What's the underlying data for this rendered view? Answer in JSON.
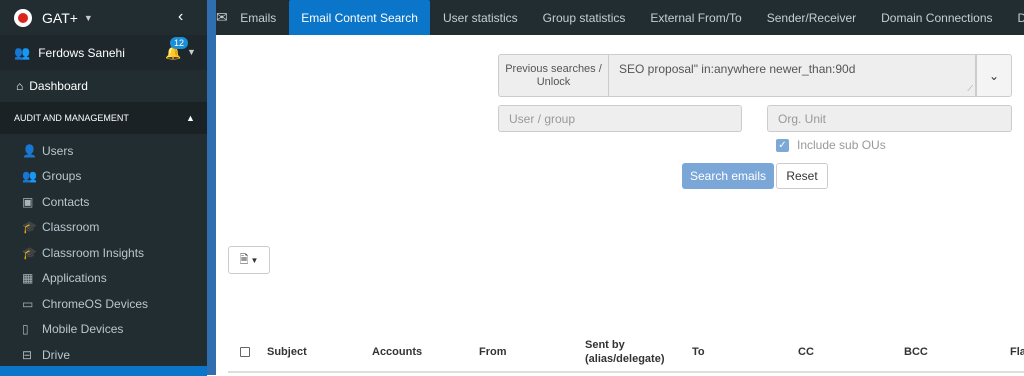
{
  "app": {
    "title": "GAT+"
  },
  "user": {
    "name": "Ferdows Sanehi",
    "notifications": "12"
  },
  "sidebar": {
    "dashboard": "Dashboard",
    "section": "AUDIT AND MANAGEMENT",
    "items": [
      {
        "label": "Users",
        "icon": "user-icon"
      },
      {
        "label": "Groups",
        "icon": "users-icon"
      },
      {
        "label": "Contacts",
        "icon": "contact-card-icon"
      },
      {
        "label": "Classroom",
        "icon": "graduation-cap-icon"
      },
      {
        "label": "Classroom Insights",
        "icon": "graduation-cap-search-icon"
      },
      {
        "label": "Applications",
        "icon": "grid-icon"
      },
      {
        "label": "ChromeOS Devices",
        "icon": "laptop-icon"
      },
      {
        "label": "Mobile Devices",
        "icon": "mobile-icon"
      },
      {
        "label": "Drive",
        "icon": "hard-drive-icon"
      }
    ]
  },
  "topnav": {
    "tabs": [
      "Emails",
      "Email Content Search",
      "User statistics",
      "Group statistics",
      "External From/To",
      "Sender/Receiver",
      "Domain Connections",
      "D"
    ],
    "active": "Email Content Search"
  },
  "search": {
    "previous_label": "Previous searches / Unlock",
    "query": "SEO proposal\" in:anywhere newer_than:90d",
    "user_group_placeholder": "User / group",
    "org_unit_placeholder": "Org. Unit",
    "include_sub_ous": "Include sub OUs",
    "search_button": "Search emails",
    "reset_button": "Reset"
  },
  "table": {
    "columns": [
      "Subject",
      "Accounts",
      "From",
      "Sent by (alias/delegate)",
      "To",
      "CC",
      "BCC",
      "Fla"
    ]
  },
  "colors": {
    "sidebar_bg": "#222d32",
    "accent": "#0a75c9",
    "search_btn": "#7aa7d7"
  }
}
